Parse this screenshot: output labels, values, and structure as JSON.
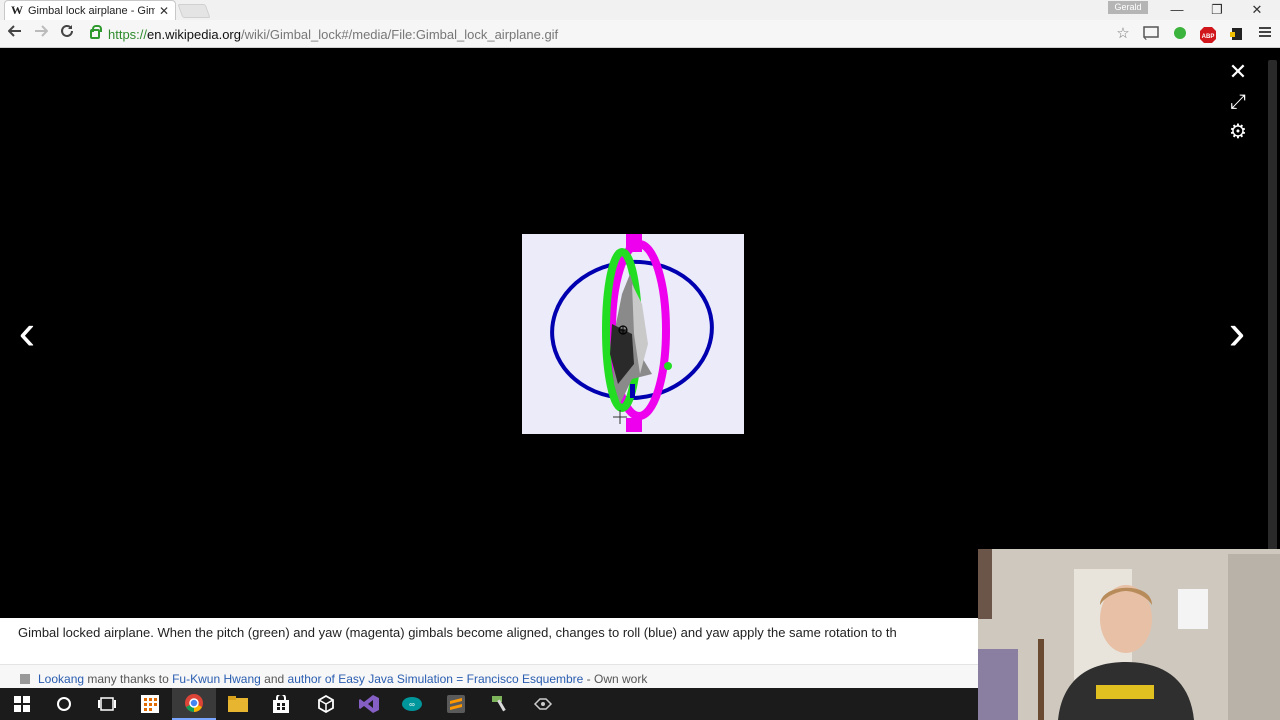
{
  "browser": {
    "tab_title": "Gimbal lock airplane - Gim",
    "tab_logo": "W",
    "tab_close": "✕",
    "user_name": "Gerald",
    "window_controls": [
      "—",
      "❐",
      "✕"
    ],
    "url": {
      "scheme": "https://",
      "host": "en.wikipedia.org",
      "path": "/wiki/Gimbal_lock#/media/File:Gimbal_lock_airplane.gif"
    },
    "nav_icons": [
      "back-arrow-icon",
      "forward-arrow-icon",
      "reload-icon"
    ],
    "extensions": [
      "star-icon",
      "cast-icon",
      "green-dot-icon",
      "adblock-icon",
      "extension-icon",
      "menu-icon"
    ],
    "adblock_label": "ABP"
  },
  "viewer": {
    "close_glyph": "✕",
    "fullscreen_glyph": "⤢",
    "settings_glyph": "⚙",
    "prev_glyph": "‹",
    "next_glyph": "›",
    "image": "Gimbal lock airplane animation frame",
    "colors": {
      "roll": "#0000b0",
      "pitch": "#22dd22",
      "yaw": "#ee00ee",
      "background": "#ebebf9"
    }
  },
  "caption": {
    "text": "Gimbal locked airplane. When the pitch (green) and yaw (magenta) gimbals become aligned, changes to roll (blue) and yaw apply the same rotation to th"
  },
  "credit": {
    "author": "Lookang",
    "mid1": " many thanks to ",
    "link2": "Fu-Kwun Hwang",
    "mid2": " and ",
    "link3": "author of Easy Java Simulation = Francisco Esquembre",
    "tail": " - Own work"
  },
  "taskbar": {
    "items": [
      "windows-start-icon",
      "cortana-circle-icon",
      "task-view-icon",
      "store-grid-icon",
      "chrome-icon",
      "file-explorer-icon",
      "store-bag-icon",
      "unity-icon",
      "visual-studio-icon",
      "arduino-icon",
      "sublime-icon",
      "hammer-icon",
      "git-icon"
    ]
  }
}
